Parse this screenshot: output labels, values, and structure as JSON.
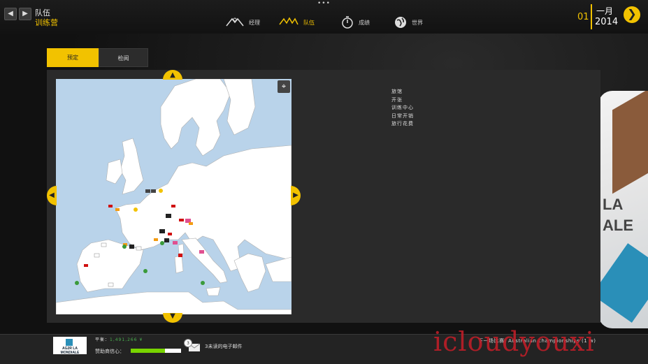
{
  "header": {
    "back_icon": "chevron-left-icon",
    "forward_icon": "chevron-right-icon",
    "breadcrumb_top": "队伍",
    "breadcrumb_sub": "训练营",
    "menu_dots": "•••",
    "nav": [
      {
        "label": "经理",
        "icon": "manager-icon"
      },
      {
        "label": "队伍",
        "icon": "team-icon"
      },
      {
        "label": "成绩",
        "icon": "stopwatch-icon"
      },
      {
        "label": "世界",
        "icon": "globe-icon"
      }
    ],
    "date_day": "01",
    "date_month": "一月",
    "date_year": "2014",
    "next_day_icon": "chevron-right-icon"
  },
  "tabs": [
    {
      "label": "预定",
      "active": true
    },
    {
      "label": "检阅",
      "active": false
    }
  ],
  "map": {
    "zoom_icon": "zoom-out-icon"
  },
  "legend": [
    "旅馆",
    "开张",
    "训练中心",
    "日常开销",
    "旅行花费"
  ],
  "footer": {
    "team_logo_text": "AG2R LA MONDIALE",
    "balance_label": "平衡：",
    "balance_value": "1,491,266 ¥",
    "sponsor_label": "赞助商信心：",
    "sponsor_confidence": 0.68,
    "mail_count": "3",
    "mail_text": "3未读的电子邮件",
    "next_race": "下一场比赛: Australian championships (1 w)"
  },
  "watermark": "icloudyouxi",
  "colors": {
    "accent": "#f2c200",
    "positive": "#49b14d",
    "sponsor_bar": "#78d400"
  }
}
